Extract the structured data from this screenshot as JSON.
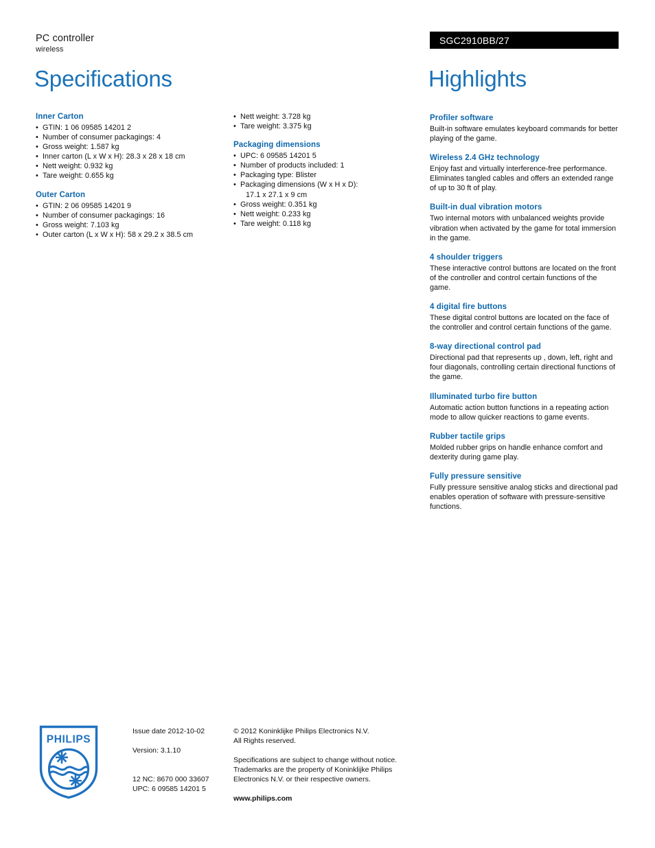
{
  "product": {
    "name": "PC controller",
    "subtitle": "wireless",
    "code": "SGC2910BB/27"
  },
  "titles": {
    "specifications": "Specifications",
    "highlights": "Highlights"
  },
  "colors": {
    "accent_title": "#1b72b8",
    "accent_heading": "#0d66ab",
    "code_bar_bg": "#000000",
    "code_bar_text": "#ffffff",
    "body_text": "#111111"
  },
  "specifications": {
    "column1": [
      {
        "heading": "Inner Carton",
        "items": [
          "GTIN: 1 06 09585 14201 2",
          "Number of consumer packagings: 4",
          "Gross weight: 1.587 kg",
          "Inner carton (L x W x H): 28.3 x 28 x 18 cm",
          "Nett weight: 0.932 kg",
          "Tare weight: 0.655 kg"
        ]
      },
      {
        "heading": "Outer Carton",
        "items": [
          "GTIN: 2 06 09585 14201 9",
          "Number of consumer packagings: 16",
          "Gross weight: 7.103 kg",
          "Outer carton (L x W x H): 58 x 29.2 x 38.5 cm"
        ]
      }
    ],
    "column2": [
      {
        "heading": "",
        "items": [
          "Nett weight: 3.728 kg",
          "Tare weight: 3.375 kg"
        ]
      },
      {
        "heading": "Packaging dimensions",
        "items": [
          "UPC: 6 09585 14201 5",
          "Number of products included: 1",
          "Packaging type: Blister",
          "Packaging dimensions (W x H x D):",
          "17.1 x 27.1 x 9 cm",
          "Gross weight: 0.351 kg",
          "Nett weight: 0.233 kg",
          "Tare weight: 0.118 kg"
        ],
        "continuation_indices": [
          4
        ]
      }
    ]
  },
  "highlights": [
    {
      "title": "Profiler software",
      "body": "Built-in software emulates keyboard commands for better playing of the game."
    },
    {
      "title": "Wireless 2.4 GHz technology",
      "body": "Enjoy fast and virtually interference-free performance. Eliminates tangled cables and offers an extended range of up to 30 ft of play."
    },
    {
      "title": "Built-in dual vibration motors",
      "body": "Two internal motors with unbalanced weights provide vibration when activated by the game for total immersion in the game."
    },
    {
      "title": "4 shoulder triggers",
      "body": "These interactive control buttons are located on the front of the controller and control certain functions of the game."
    },
    {
      "title": "4 digital fire buttons",
      "body": "These digital control buttons are located on the face of the controller and control certain functions of the game."
    },
    {
      "title": "8-way directional control pad",
      "body": "Directional pad that represents up , down, left, right and four diagonals, controlling certain directional functions of the game."
    },
    {
      "title": "Illuminated turbo fire button",
      "body": "Automatic action button functions in a repeating action mode to allow quicker reactions to game events."
    },
    {
      "title": "Rubber tactile grips",
      "body": "Molded rubber grips on handle enhance comfort and dexterity during game play."
    },
    {
      "title": "Fully pressure sensitive",
      "body": "Fully pressure sensitive analog sticks and directional pad enables operation of software with pressure-sensitive functions."
    }
  ],
  "footer": {
    "logo_wordmark": "PHILIPS",
    "issue_date": "Issue date 2012-10-02",
    "version": "Version: 3.1.10",
    "nc_code": "12 NC: 8670 000 33607",
    "upc": "UPC: 6 09585 14201 5",
    "copyright_line1": "© 2012 Koninklijke Philips Electronics N.V.",
    "copyright_line2": "All Rights reserved.",
    "disclaimer_line1": "Specifications are subject to change without notice.",
    "disclaimer_line2": "Trademarks are the property of Koninklijke Philips",
    "disclaimer_line3": "Electronics N.V. or their respective owners.",
    "website": "www.philips.com"
  }
}
